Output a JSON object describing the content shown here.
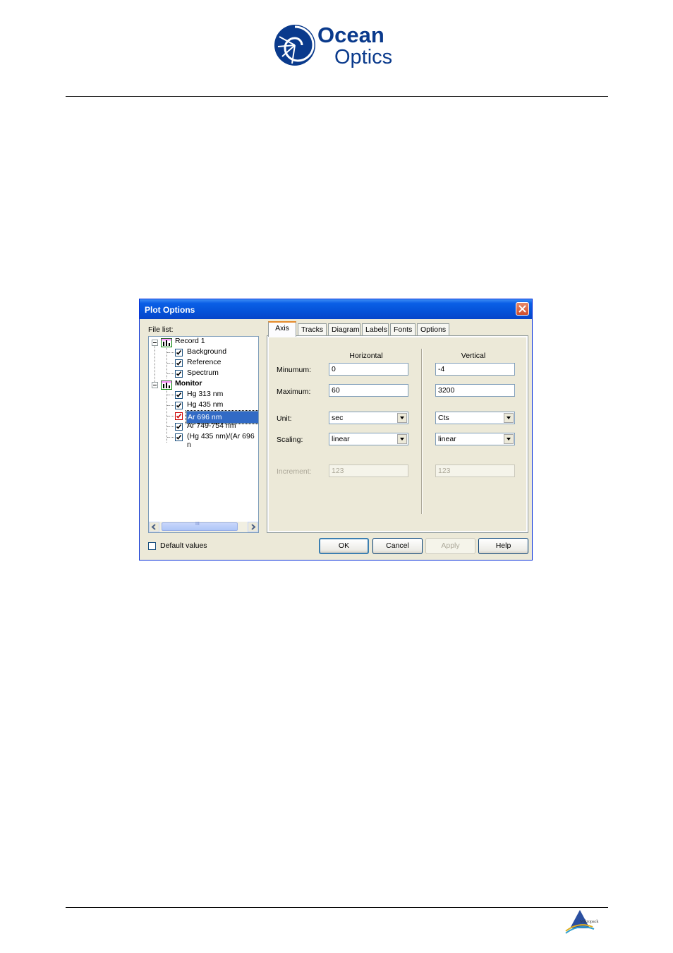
{
  "document": {
    "footer_logo_text": "Mikropack"
  },
  "logo": {
    "line1": "Ocean",
    "line2": "Optics",
    "brand_color": "#0a3a8c"
  },
  "dialog": {
    "title": "Plot Options",
    "file_list_label": "File list:",
    "tree": [
      {
        "label": "Record 1",
        "level": 0,
        "checked": null,
        "bold": false,
        "selected": false
      },
      {
        "label": "Background",
        "level": 1,
        "checked": true,
        "bold": false,
        "selected": false
      },
      {
        "label": "Reference",
        "level": 1,
        "checked": true,
        "bold": false,
        "selected": false
      },
      {
        "label": "Spectrum",
        "level": 1,
        "checked": true,
        "bold": false,
        "selected": false
      },
      {
        "label": "Monitor",
        "level": 0,
        "checked": null,
        "bold": true,
        "selected": false
      },
      {
        "label": "Hg 313 nm",
        "level": 1,
        "checked": true,
        "bold": false,
        "selected": false
      },
      {
        "label": "Hg 435 nm",
        "level": 1,
        "checked": true,
        "bold": false,
        "selected": false
      },
      {
        "label": "Ar 696 nm",
        "level": 1,
        "checked": true,
        "bold": false,
        "selected": true
      },
      {
        "label": "Ar 749-754 nm",
        "level": 1,
        "checked": true,
        "bold": false,
        "selected": false
      },
      {
        "label": "(Hg 435 nm)/(Ar 696 n",
        "level": 1,
        "checked": true,
        "bold": false,
        "selected": false
      }
    ],
    "default_values_label": "Default values",
    "tabs": [
      "Axis",
      "Tracks",
      "Diagram",
      "Labels",
      "Fonts",
      "Options"
    ],
    "active_tab": "Axis",
    "axis": {
      "horizontal_header": "Horizontal",
      "vertical_header": "Vertical",
      "minimum_label": "Minumum:",
      "maximum_label": "Maximum:",
      "unit_label": "Unit:",
      "scaling_label": "Scaling:",
      "increment_label": "Increment:",
      "h_min": "0",
      "h_max": "60",
      "h_unit": "sec",
      "h_scaling": "linear",
      "h_increment": "123",
      "v_min": "-4",
      "v_max": "3200",
      "v_unit": "Cts",
      "v_scaling": "linear",
      "v_increment": "123"
    },
    "buttons": {
      "ok": "OK",
      "cancel": "Cancel",
      "apply": "Apply",
      "help": "Help"
    },
    "scroll_grip": "III"
  }
}
